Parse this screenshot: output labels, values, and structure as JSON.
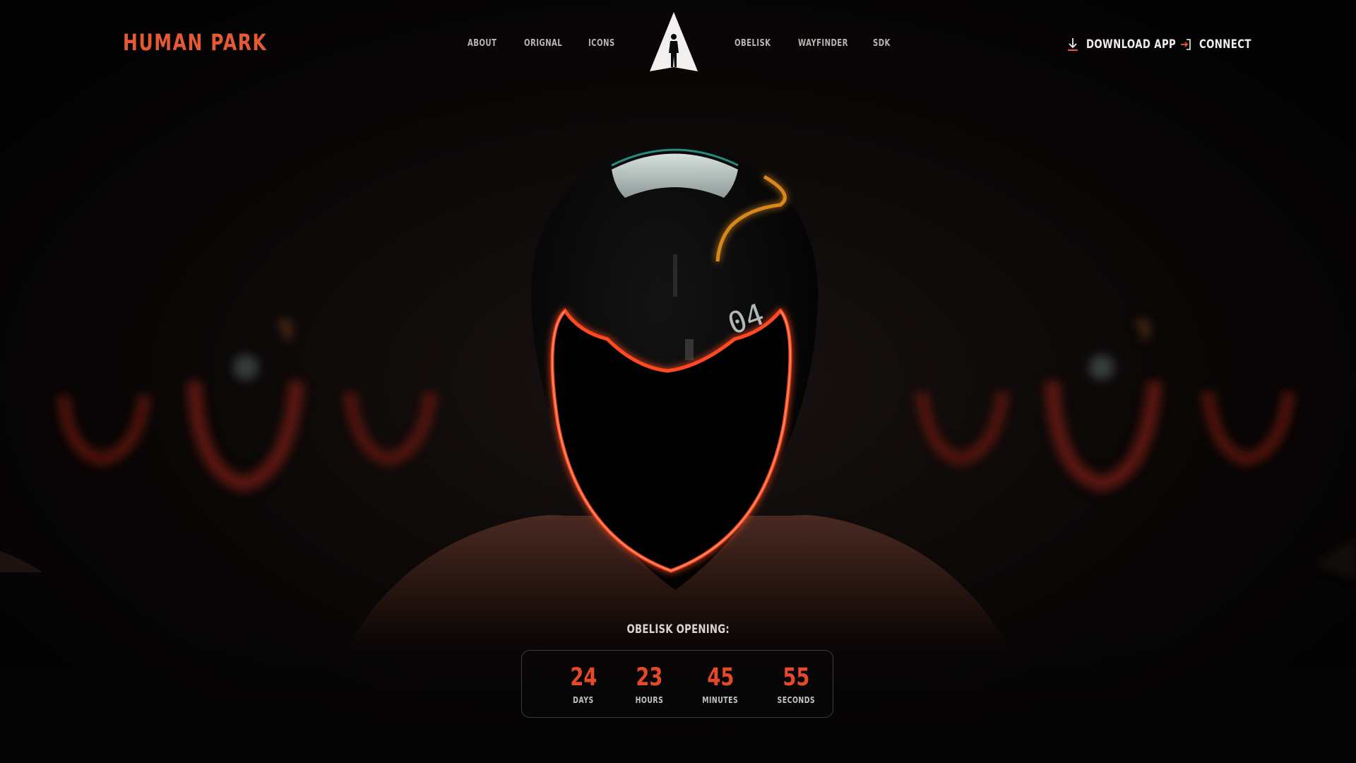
{
  "header": {
    "brand": "HUMAN PARK",
    "nav_left": [
      "ABOUT",
      "ORIGNAL",
      "ICONS"
    ],
    "nav_right": [
      "OBELISK",
      "WAYFINDER",
      "SDK"
    ],
    "logo_icon": "obelisk-figure-logo-icon",
    "download_label": "DOWNLOAD APP",
    "download_icon": "download-icon",
    "connect_label": "CONNECT",
    "connect_icon": "login-arrow-icon"
  },
  "hero": {
    "helmet_display": "04"
  },
  "countdown": {
    "title": "OBELISK OPENING:",
    "units": [
      {
        "value": "24",
        "label": "DAYS"
      },
      {
        "value": "23",
        "label": "HOURS"
      },
      {
        "value": "45",
        "label": "MINUTES"
      },
      {
        "value": "55",
        "label": "SECONDS"
      }
    ]
  },
  "colors": {
    "accent": "#e55a35",
    "countdown_value": "#e44a2a",
    "glow": "#ff5a2a",
    "background": "#050404"
  }
}
